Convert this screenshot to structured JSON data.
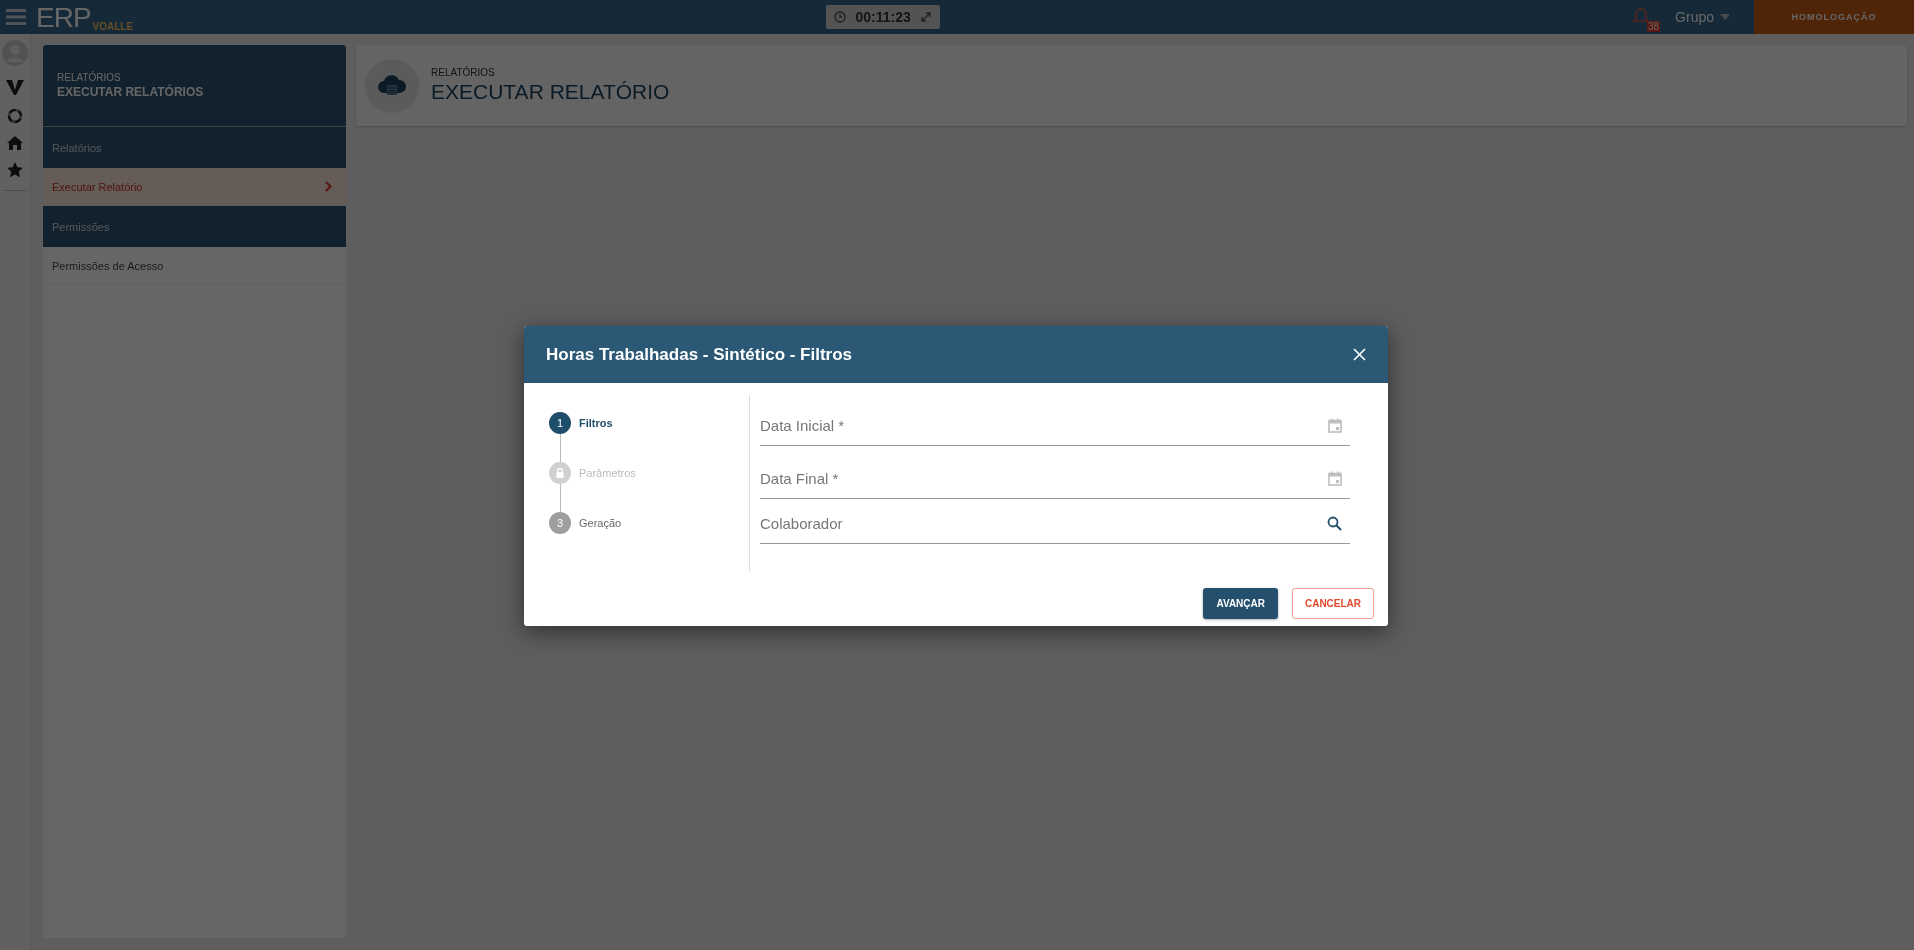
{
  "topbar": {
    "logo": "ERP",
    "logo_sub": "VOALLE",
    "timer": "00:11:23",
    "notifications": "38",
    "group": "Grupo",
    "environment": "HOMOLOGAÇÃO"
  },
  "sidebar": {
    "breadcrumb": "RELATÓRIOS",
    "title": "EXECUTAR RELATÓRIOS",
    "groups": [
      {
        "label": "Relatórios",
        "items": [
          {
            "label": "Executar Relatório",
            "selected": true
          }
        ]
      },
      {
        "label": "Permissões",
        "items": [
          {
            "label": "Permissões de Acesso",
            "selected": false
          }
        ]
      }
    ]
  },
  "page_header": {
    "breadcrumb": "RELATÓRIOS",
    "title": "EXECUTAR RELATÓRIO"
  },
  "dialog": {
    "title": "Horas Trabalhadas - Sintético - Filtros",
    "steps": [
      {
        "number": "1",
        "label": "Filtros",
        "kind": "active"
      },
      {
        "label": "Parâmetros",
        "kind": "locked"
      },
      {
        "number": "3",
        "label": "Geração",
        "kind": "pending"
      }
    ],
    "fields": [
      {
        "placeholder": "Data Inicial *",
        "kind": "date"
      },
      {
        "placeholder": "Data Final *",
        "kind": "date"
      },
      {
        "placeholder": "Colaborador",
        "kind": "search"
      }
    ],
    "buttons": [
      {
        "label": "AVANÇAR",
        "kind": "primary"
      },
      {
        "label": "CANCELAR",
        "kind": "secondary"
      }
    ]
  }
}
